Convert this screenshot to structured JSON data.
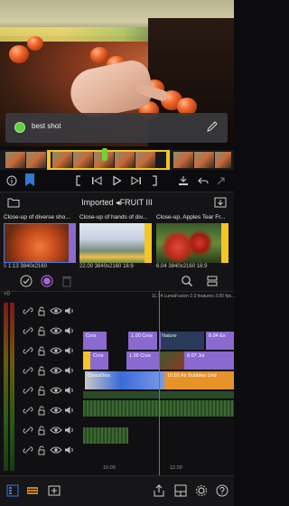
{
  "viewer": {
    "bookmark": {
      "label": "best shot",
      "color": "#5fd13c"
    }
  },
  "library": {
    "title": "Imported ◂FRUIT III",
    "clips": [
      {
        "name": "Close-up of diverse sho...",
        "duration": "1:13",
        "resolution": "3840x2160",
        "aspect": "",
        "selected": true
      },
      {
        "name": "Close-up of hands of div...",
        "duration": "22.00",
        "resolution": "3840x2160",
        "aspect": "16:9",
        "selected": false
      },
      {
        "name": "Close-up, Apples Tear Fr...",
        "duration": "6.04",
        "resolution": "3840x2160",
        "aspect": "16:9",
        "selected": false
      }
    ]
  },
  "timeline": {
    "info": "11.14  LumaFusion 2.0 features 3.00 fps...",
    "clips": [
      {
        "label": "Cros",
        "track": 2
      },
      {
        "label": "1.00  Cros",
        "track": 2
      },
      {
        "label": "Nature",
        "track": 2
      },
      {
        "label": "8.04  Ex",
        "track": 2
      },
      {
        "label": "Cros",
        "track": 3
      },
      {
        "label": "1.00  Cros",
        "track": 3
      },
      {
        "label": "8.07  Jui",
        "track": 3
      },
      {
        "label": "CrossDiss",
        "track": 4
      },
      {
        "label": "10.02  Air Bubbles Und",
        "track": 4
      }
    ],
    "timecodes": [
      "10.00",
      "12.00"
    ]
  },
  "colors": {
    "accent": "#f3c623",
    "playhead": "#3a7be0",
    "purple_clip": "#8a6ad0",
    "blue_clip": "#3a6ad8",
    "orange_clip": "#e8922a",
    "audio_green": "#3a6a32"
  }
}
